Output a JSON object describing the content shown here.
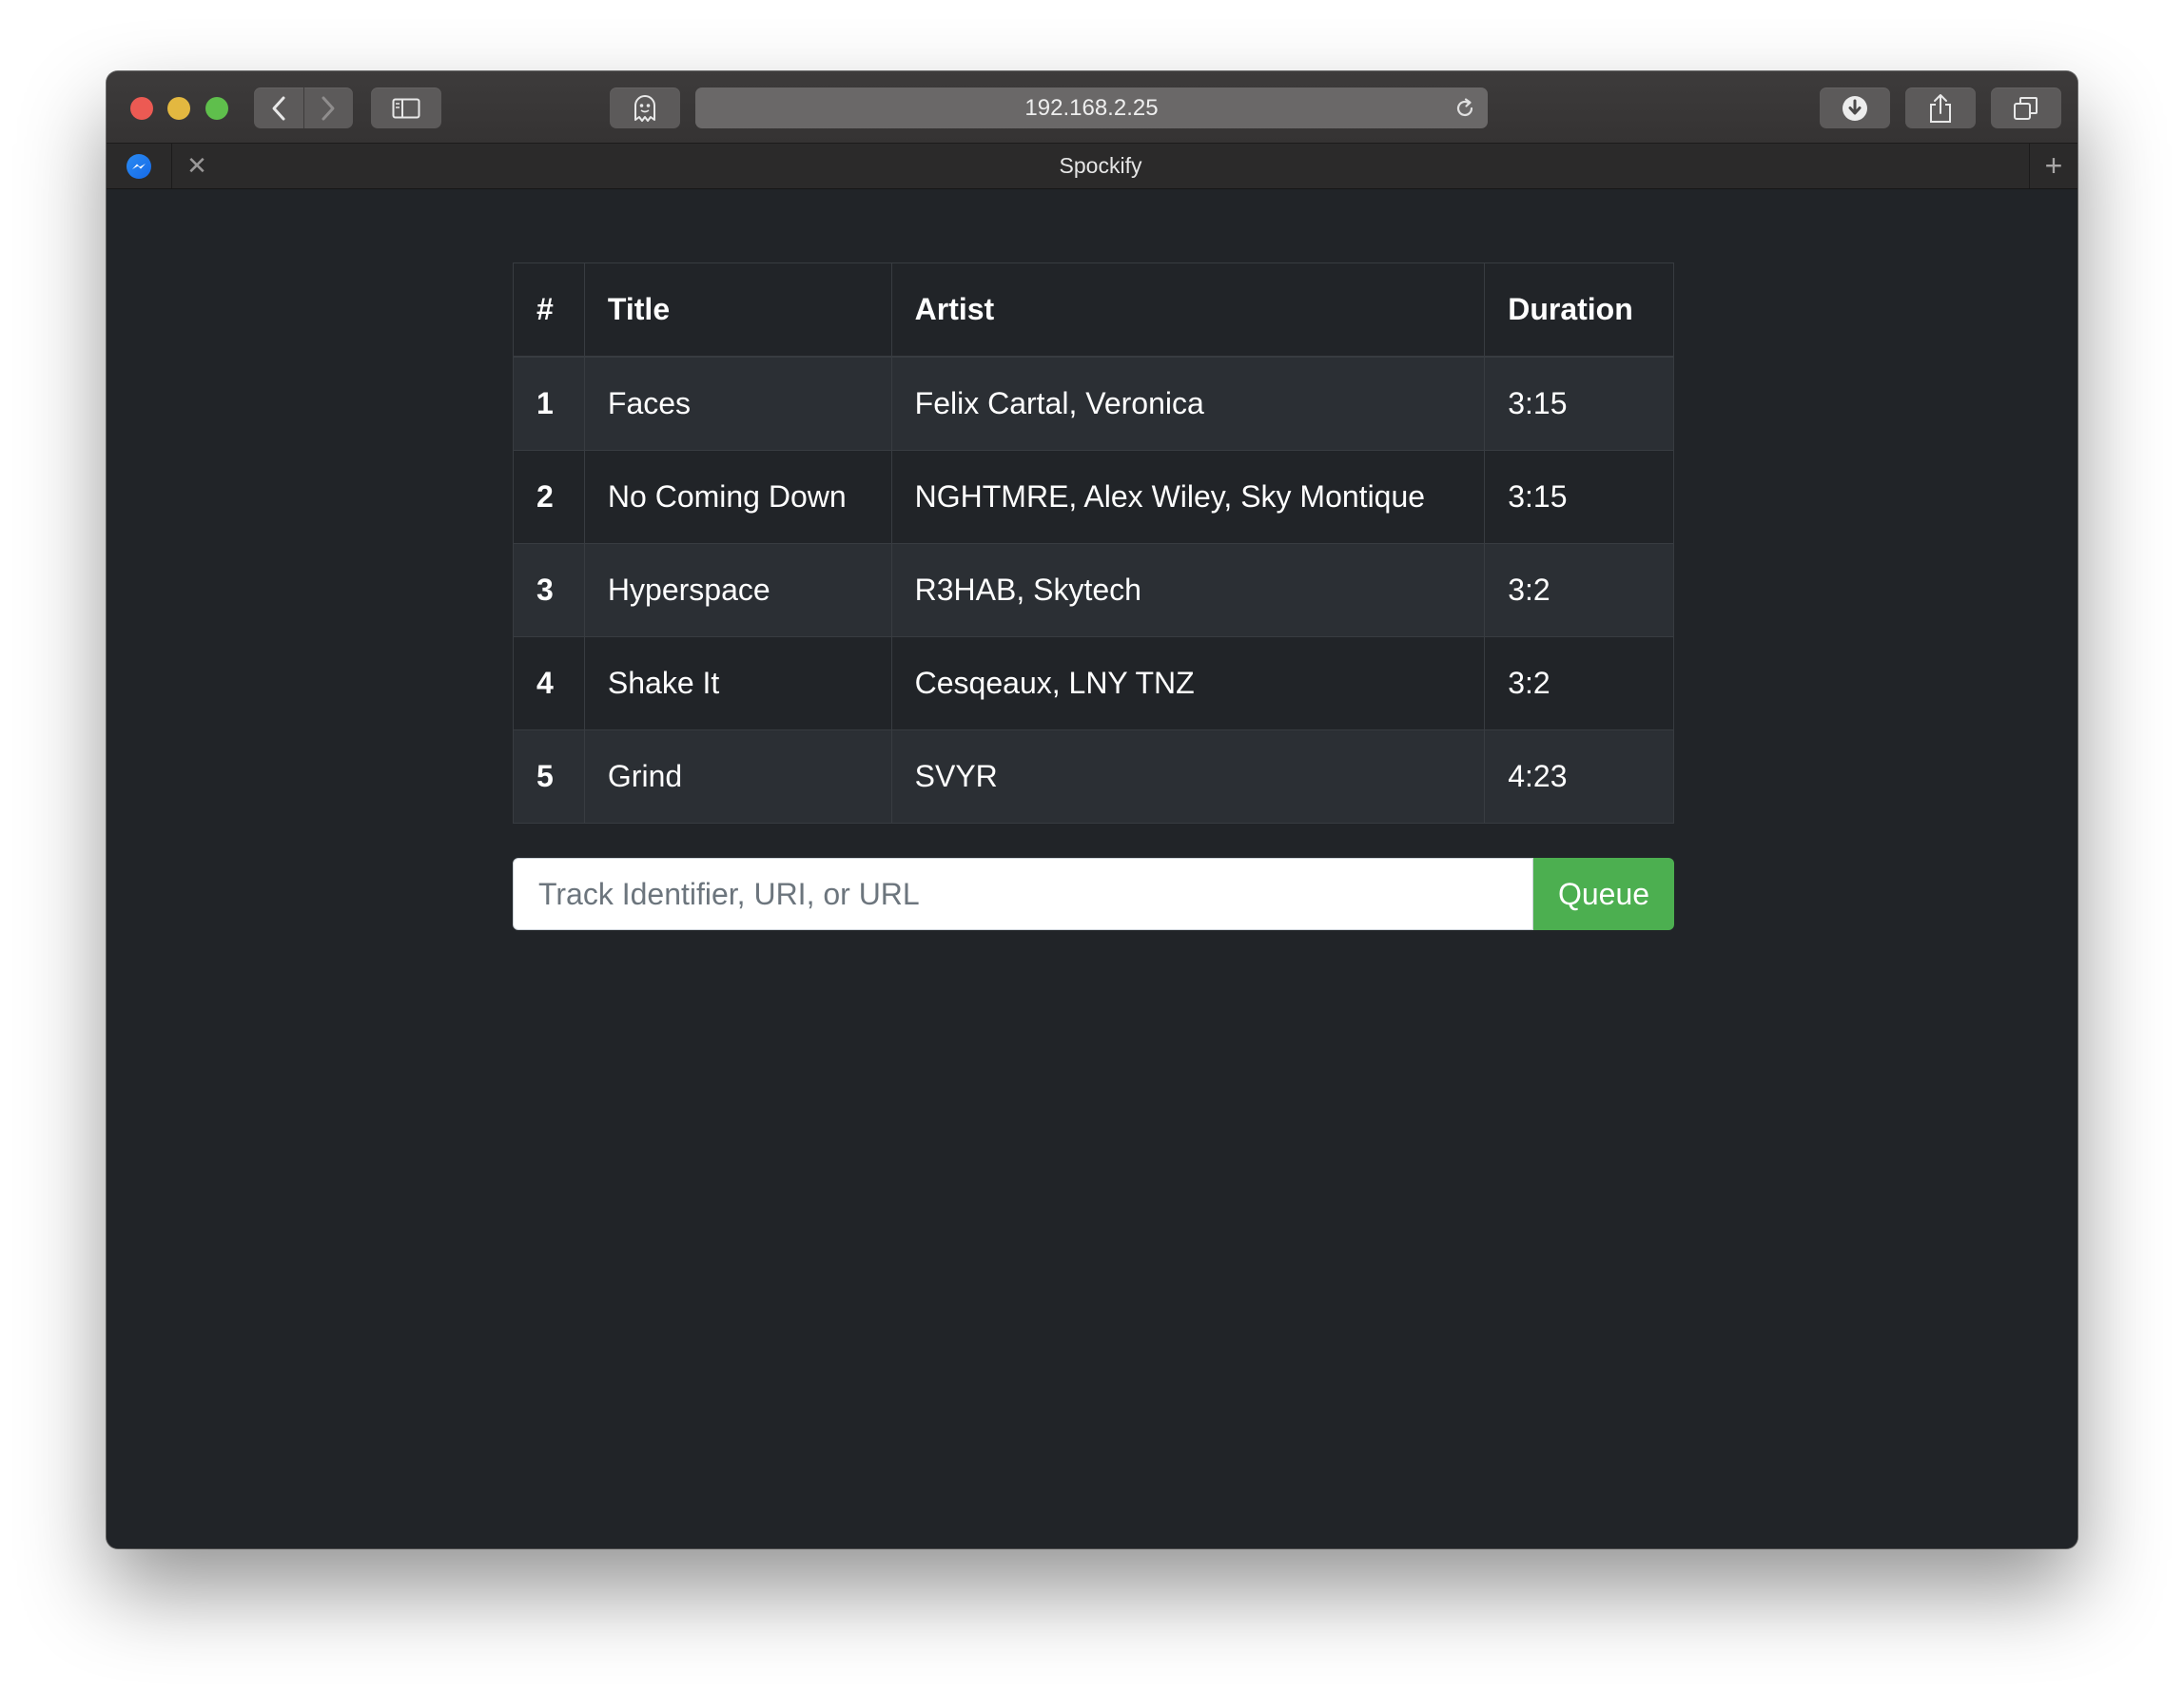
{
  "browser": {
    "address_url": "192.168.2.25",
    "tab_title": "Spockify",
    "tab_close_glyph": "✕",
    "new_tab_glyph": "+",
    "icons": {
      "back": "chevron-left-icon",
      "forward": "chevron-right-icon",
      "sidebar": "sidebar-icon",
      "ghostery": "ghost-icon",
      "reload": "reload-icon",
      "downloads": "download-icon",
      "share": "share-icon",
      "tabs": "tabs-overview-icon",
      "pinned": "messenger-icon"
    }
  },
  "queue_table": {
    "headers": [
      "#",
      "Title",
      "Artist",
      "Duration"
    ],
    "rows": [
      {
        "num": "1",
        "title": "Faces",
        "artist": "Felix Cartal, Veronica",
        "duration": "3:15"
      },
      {
        "num": "2",
        "title": "No Coming Down",
        "artist": "NGHTMRE, Alex Wiley, Sky Montique",
        "duration": "3:15"
      },
      {
        "num": "3",
        "title": "Hyperspace",
        "artist": "R3HAB, Skytech",
        "duration": "3:2"
      },
      {
        "num": "4",
        "title": "Shake It",
        "artist": "Cesqeaux, LNY TNZ",
        "duration": "3:2"
      },
      {
        "num": "5",
        "title": "Grind",
        "artist": "SVYR",
        "duration": "4:23"
      }
    ]
  },
  "queue_form": {
    "placeholder": "Track Identifier, URI, or URL",
    "value": "",
    "button_label": "Queue"
  },
  "colors": {
    "page_background": "#212428",
    "queue_button": "#4caf50",
    "stripe_row": "#2b2f34"
  }
}
